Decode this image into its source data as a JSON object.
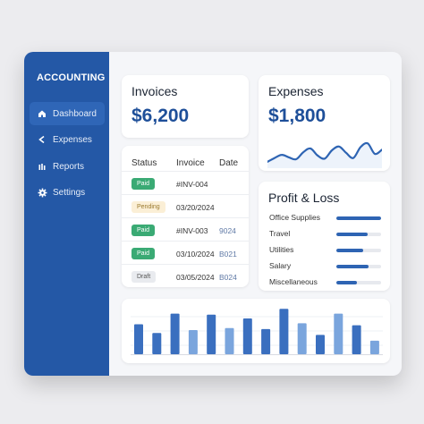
{
  "sidebar": {
    "brand": "ACCOUNTING",
    "items": [
      {
        "label": "Dashboard",
        "icon": "home-icon",
        "active": true
      },
      {
        "label": "Expenses",
        "icon": "share-icon",
        "active": false
      },
      {
        "label": "Reports",
        "icon": "bars-icon",
        "active": false
      },
      {
        "label": "Settings",
        "icon": "gear-icon",
        "active": false
      }
    ]
  },
  "invoices_card": {
    "title": "Invoices",
    "amount": "$6,200"
  },
  "expenses_card": {
    "title": "Expenses",
    "amount": "$1,800"
  },
  "invoice_table": {
    "headers": [
      "Status",
      "Invoice",
      "Date"
    ],
    "rows": [
      {
        "status": "Paid",
        "status_color": "#3aaa74",
        "invoice": "#INV-004",
        "date": "",
        "extra": ""
      },
      {
        "status": "Pending",
        "status_color": "#e8c27a",
        "invoice": "03/20/2024",
        "date": "",
        "extra": ""
      },
      {
        "status": "Paid",
        "status_color": "#3aaa74",
        "invoice": "#INV-003",
        "date": "",
        "extra": "9024"
      },
      {
        "status": "Paid",
        "status_color": "#3aaa74",
        "invoice": "03/10/2024",
        "date": "",
        "extra": "B021"
      },
      {
        "status": "Draft",
        "status_color": "#b6bcc6",
        "invoice": "03/05/2024",
        "date": "",
        "extra": "B024"
      }
    ]
  },
  "profit_loss": {
    "title": "Profit & Loss",
    "items": [
      {
        "label": "Office Supplies",
        "value": 1.0
      },
      {
        "label": "Travel",
        "value": 0.7
      },
      {
        "label": "Utilities",
        "value": 0.6
      },
      {
        "label": "Salary",
        "value": 0.72
      },
      {
        "label": "Miscellaneous",
        "value": 0.46
      }
    ]
  },
  "colors": {
    "accent": "#2458a6",
    "bar_dark": "#3a6fbf",
    "bar_light": "#7aa5dd"
  },
  "chart_data": [
    {
      "type": "line",
      "x": [
        0,
        1,
        2,
        3,
        4,
        5,
        6,
        7,
        8,
        9,
        10,
        11,
        12,
        13,
        14,
        15,
        16
      ],
      "y": [
        2,
        3.2,
        4.2,
        3.4,
        2.8,
        5.0,
        6.2,
        4.0,
        3.0,
        5.6,
        6.8,
        4.8,
        3.2,
        6.6,
        7.8,
        4.5,
        5.8
      ],
      "ylim": [
        0,
        9
      ]
    },
    {
      "type": "bar",
      "values": [
        31,
        22,
        42,
        25,
        41,
        27,
        37,
        26,
        47,
        32,
        20,
        42,
        30,
        14
      ],
      "shade": [
        "dark",
        "dark",
        "dark",
        "light",
        "dark",
        "light",
        "dark",
        "dark",
        "dark",
        "light",
        "dark",
        "light",
        "dark",
        "light"
      ],
      "ylim": [
        0,
        50
      ]
    }
  ]
}
